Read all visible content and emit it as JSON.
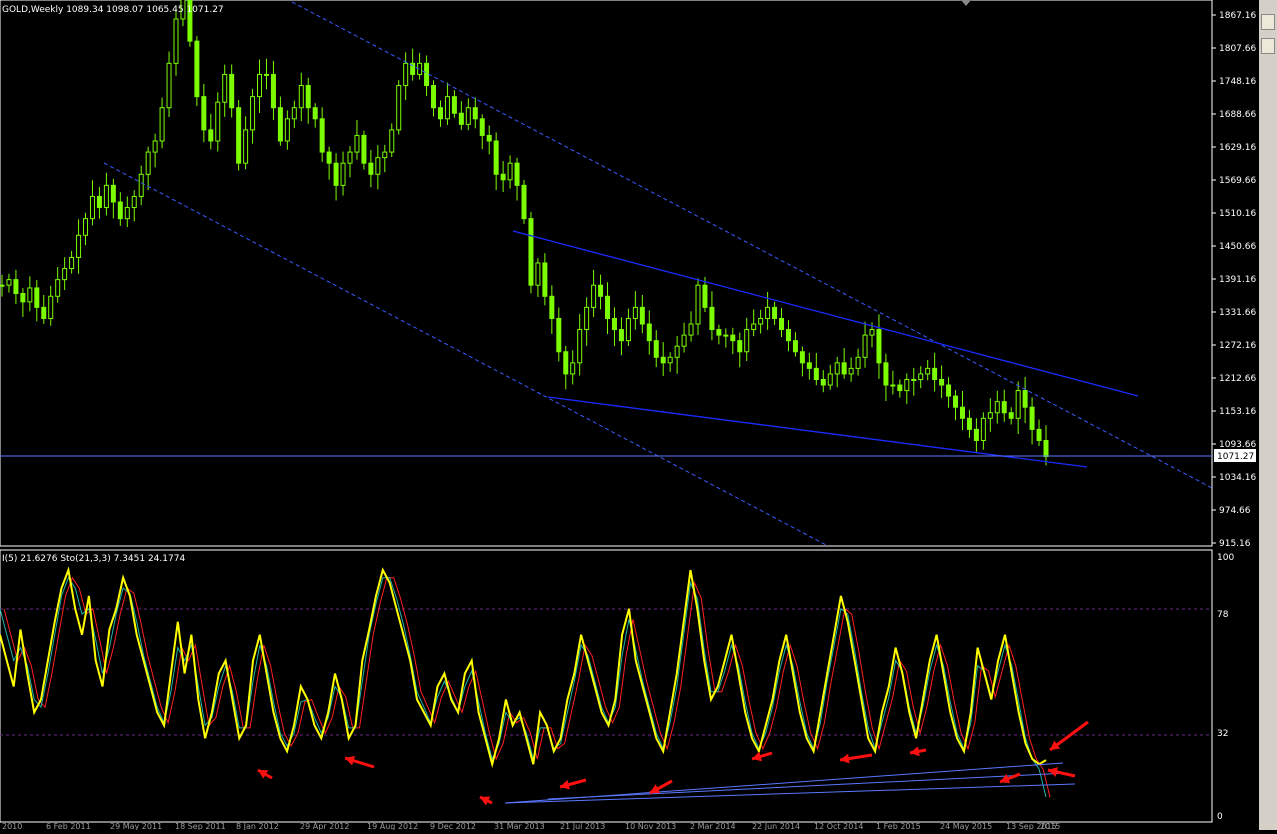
{
  "main_chart": {
    "header": "GOLD,Weekly  1089.34 1098.07 1065.45 1071.27",
    "current_price_label": "1071.27",
    "price_axis_labels": [
      "1867.16",
      "1807.66",
      "1748.16",
      "1688.66",
      "1629.16",
      "1569.66",
      "1510.16",
      "1450.66",
      "1391.16",
      "1331.66",
      "1272.16",
      "1212.66",
      "1153.16",
      "1093.66",
      "1034.16",
      "974.66",
      "915.16"
    ],
    "colors": {
      "candle": "#7CFC00",
      "trendline": "#1a2bff",
      "channel": "#3b5bff",
      "bg": "#000000",
      "grid_line": "#ffffff",
      "price_line": "#5f78ff"
    }
  },
  "indicator": {
    "header": "I(5) 21.6276  Sto(21,3,3) 7.3451 24.1774",
    "axis_labels": [
      "100",
      "78",
      "32",
      "0"
    ],
    "colors": {
      "rsi": "#ffff00",
      "stoch_main": "#20b2aa",
      "stoch_signal": "#ff2020",
      "level": "#6a2a8a",
      "arrow": "#ff1010"
    }
  },
  "date_axis_labels": [
    "2010",
    "6 Feb 2011",
    "29 May 2011",
    "18 Sep 2011",
    "8 Jan 2012",
    "29 Apr 2012",
    "19 Aug 2012",
    "9 Dec 2012",
    "31 Mar 2013",
    "21 Jul 2013",
    "10 Nov 2013",
    "2 Mar 2014",
    "22 Jun 2014",
    "12 Oct 2014",
    "1 Feb 2015",
    "24 May 2015",
    "13 Sep 2015",
    "2015"
  ],
  "chart_data": {
    "type": "candlestick",
    "symbol": "GOLD",
    "timeframe": "Weekly",
    "last_bar": {
      "open": 1089.34,
      "high": 1098.07,
      "low": 1065.45,
      "close": 1071.27
    },
    "ylim": [
      915.16,
      1890
    ],
    "series": [
      {
        "name": "GOLD",
        "close_path": [
          1380,
          1390,
          1365,
          1350,
          1375,
          1340,
          1320,
          1360,
          1390,
          1410,
          1430,
          1470,
          1500,
          1540,
          1520,
          1560,
          1530,
          1500,
          1520,
          1540,
          1580,
          1620,
          1640,
          1700,
          1780,
          1860,
          1900,
          1820,
          1720,
          1660,
          1640,
          1710,
          1760,
          1700,
          1600,
          1660,
          1720,
          1760,
          1760,
          1700,
          1640,
          1680,
          1700,
          1740,
          1700,
          1680,
          1620,
          1600,
          1560,
          1600,
          1620,
          1650,
          1600,
          1580,
          1610,
          1620,
          1660,
          1740,
          1780,
          1760,
          1780,
          1740,
          1700,
          1680,
          1720,
          1690,
          1670,
          1700,
          1680,
          1650,
          1640,
          1580,
          1570,
          1600,
          1560,
          1500,
          1380,
          1420,
          1360,
          1320,
          1260,
          1220,
          1240,
          1300,
          1340,
          1380,
          1360,
          1320,
          1300,
          1280,
          1320,
          1340,
          1310,
          1280,
          1250,
          1240,
          1250,
          1270,
          1290,
          1310,
          1380,
          1340,
          1300,
          1290,
          1290,
          1280,
          1260,
          1300,
          1310,
          1320,
          1340,
          1320,
          1300,
          1280,
          1260,
          1240,
          1230,
          1210,
          1200,
          1220,
          1240,
          1220,
          1230,
          1250,
          1290,
          1300,
          1240,
          1200,
          1200,
          1190,
          1210,
          1210,
          1220,
          1230,
          1210,
          1200,
          1180,
          1160,
          1140,
          1120,
          1100,
          1140,
          1150,
          1170,
          1150,
          1140,
          1190,
          1160,
          1120,
          1100,
          1071
        ]
      }
    ],
    "indicators": {
      "rsi_period": 5,
      "rsi_value": 21.6276,
      "stochastic": {
        "k": 21,
        "d": 3,
        "slowing": 3,
        "main": 7.3451,
        "signal": 24.1774
      },
      "levels": [
        78,
        32
      ],
      "rsi_path": [
        70,
        60,
        50,
        72,
        55,
        40,
        45,
        60,
        75,
        88,
        95,
        80,
        70,
        85,
        60,
        50,
        72,
        80,
        92,
        85,
        70,
        60,
        50,
        40,
        35,
        55,
        75,
        55,
        70,
        45,
        30,
        40,
        55,
        60,
        45,
        30,
        35,
        60,
        70,
        55,
        40,
        30,
        25,
        35,
        50,
        45,
        35,
        30,
        40,
        55,
        45,
        30,
        35,
        60,
        72,
        85,
        95,
        90,
        80,
        70,
        60,
        45,
        40,
        35,
        50,
        55,
        45,
        40,
        55,
        60,
        40,
        30,
        20,
        30,
        45,
        35,
        40,
        30,
        20,
        40,
        35,
        25,
        30,
        45,
        55,
        70,
        60,
        50,
        40,
        35,
        45,
        70,
        80,
        60,
        50,
        40,
        30,
        25,
        40,
        55,
        75,
        95,
        80,
        60,
        45,
        50,
        60,
        70,
        55,
        40,
        30,
        25,
        35,
        45,
        60,
        70,
        55,
        40,
        30,
        25,
        40,
        55,
        70,
        85,
        75,
        60,
        45,
        30,
        25,
        40,
        50,
        65,
        55,
        40,
        30,
        45,
        60,
        70,
        55,
        40,
        30,
        25,
        40,
        65,
        55,
        45,
        60,
        70,
        55,
        40,
        28,
        22,
        20,
        21.6
      ],
      "stoch_path": [
        80,
        70,
        60,
        65,
        58,
        45,
        42,
        55,
        70,
        85,
        92,
        88,
        78,
        80,
        68,
        55,
        65,
        78,
        88,
        86,
        75,
        62,
        52,
        42,
        36,
        48,
        65,
        60,
        66,
        50,
        35,
        38,
        50,
        58,
        48,
        34,
        34,
        52,
        66,
        58,
        44,
        32,
        27,
        32,
        44,
        45,
        38,
        32,
        38,
        50,
        46,
        34,
        34,
        52,
        70,
        82,
        92,
        92,
        84,
        74,
        62,
        48,
        42,
        36,
        46,
        52,
        46,
        40,
        50,
        56,
        44,
        32,
        22,
        28,
        40,
        36,
        38,
        32,
        22,
        34,
        34,
        26,
        28,
        40,
        52,
        66,
        62,
        52,
        42,
        36,
        42,
        62,
        76,
        64,
        52,
        42,
        32,
        26,
        36,
        50,
        70,
        90,
        84,
        64,
        48,
        48,
        56,
        66,
        58,
        44,
        32,
        26,
        32,
        42,
        56,
        66,
        58,
        44,
        32,
        26,
        36,
        52,
        66,
        80,
        78,
        64,
        48,
        34,
        26,
        36,
        46,
        60,
        56,
        42,
        32,
        42,
        56,
        66,
        58,
        44,
        32,
        26,
        36,
        58,
        56,
        46,
        56,
        66,
        58,
        44,
        30,
        22,
        18,
        7.3
      ]
    }
  }
}
